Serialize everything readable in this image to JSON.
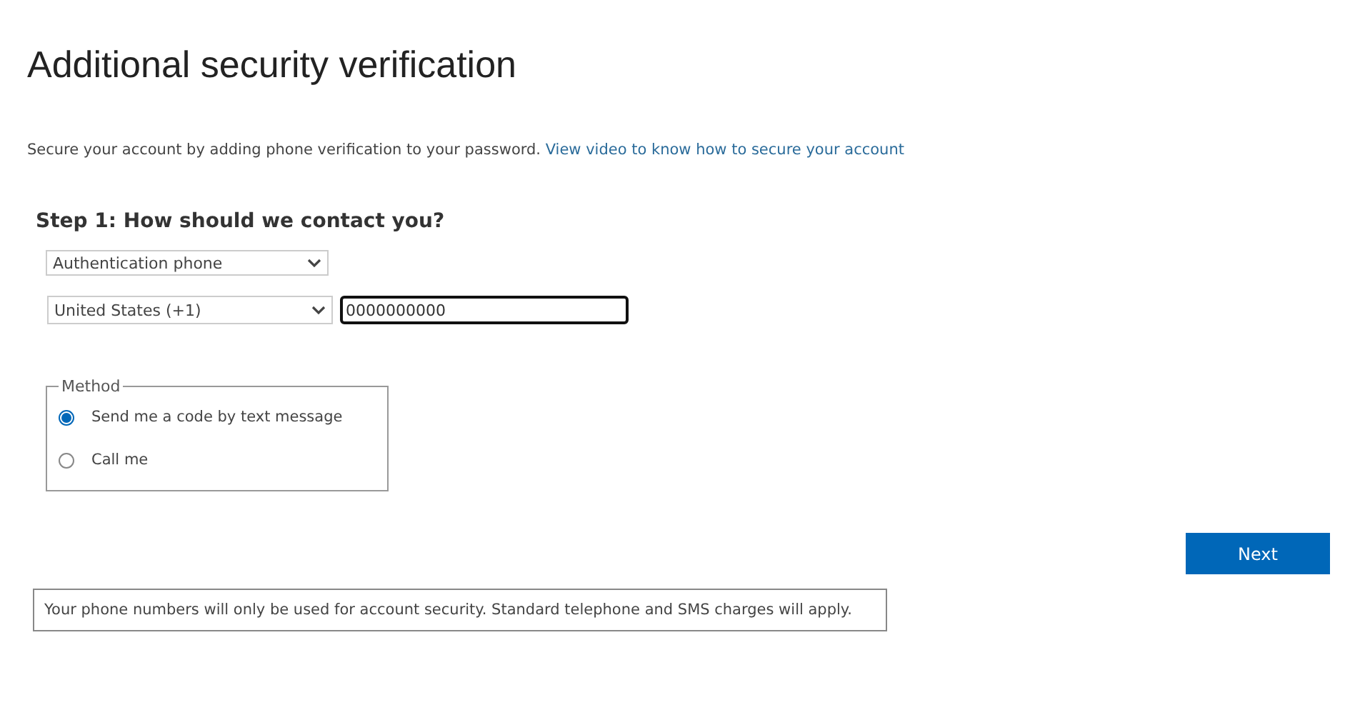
{
  "title": "Additional security verification",
  "intro": {
    "text": "Secure your account by adding phone verification to your password.",
    "link": "View video to know how to secure your account"
  },
  "step_heading": "Step 1: How should we contact you?",
  "contact_type": {
    "value": "Authentication phone"
  },
  "country": {
    "value": "United States (+1)"
  },
  "phone": {
    "value": "0000000000"
  },
  "method": {
    "legend": "Method",
    "options": [
      {
        "label": "Send me a code by text message",
        "selected": true
      },
      {
        "label": "Call me",
        "selected": false
      }
    ]
  },
  "next_button": "Next",
  "notice": "Your phone numbers will only be used for account security. Standard telephone and SMS charges will apply."
}
